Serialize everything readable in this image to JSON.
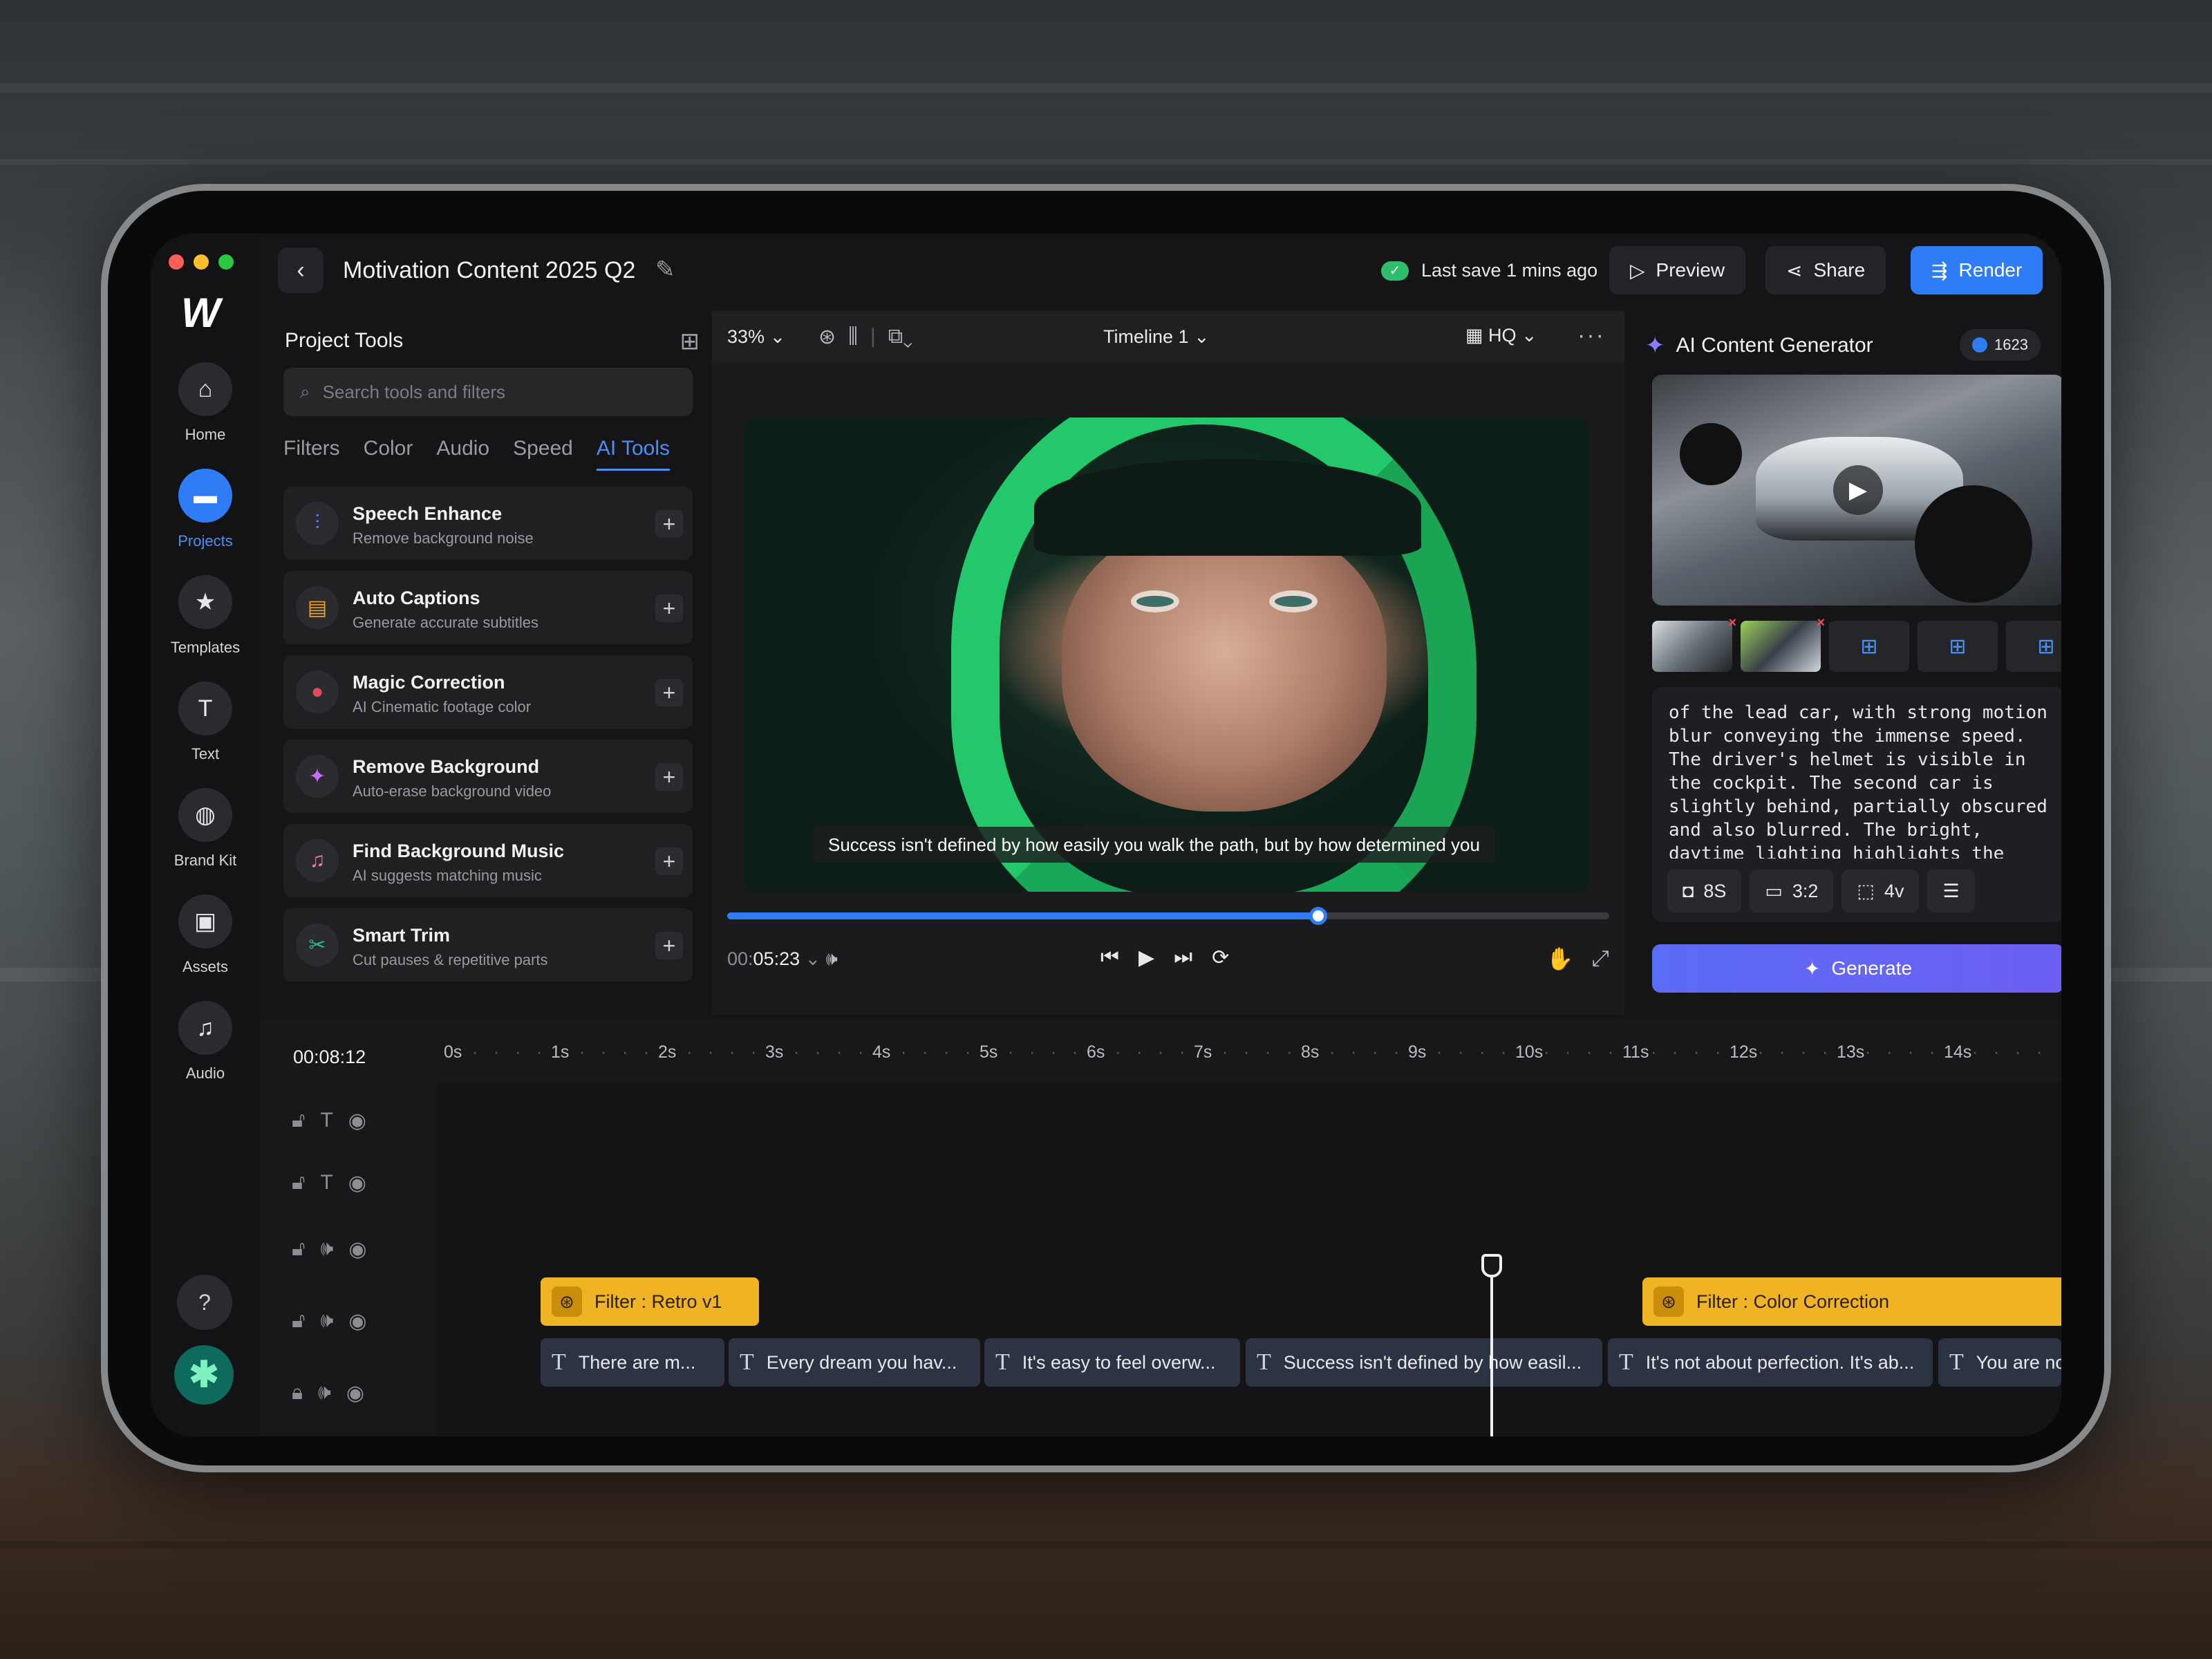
{
  "window": {
    "dots": [
      "#ff5f57",
      "#febc2e",
      "#28c840"
    ]
  },
  "nav": {
    "logo": "W",
    "items": [
      {
        "label": "Home",
        "icon": "home-icon",
        "glyph": "⌂"
      },
      {
        "label": "Projects",
        "icon": "folder-icon",
        "glyph": "▬"
      },
      {
        "label": "Templates",
        "icon": "star-icon",
        "glyph": "★"
      },
      {
        "label": "Text",
        "icon": "text-icon",
        "glyph": "T"
      },
      {
        "label": "Brand Kit",
        "icon": "palette-icon",
        "glyph": "◍"
      },
      {
        "label": "Assets",
        "icon": "image-icon",
        "glyph": "▣"
      },
      {
        "label": "Audio",
        "icon": "music-icon",
        "glyph": "♫"
      }
    ],
    "active": "Projects",
    "help_glyph": "?",
    "avatar_glyph": "✱"
  },
  "header": {
    "title": "Motivation Content 2025 Q2",
    "save_status": "Last save 1 mins ago",
    "preview_label": "Preview",
    "share_label": "Share",
    "render_label": "Render"
  },
  "tools": {
    "title": "Project Tools",
    "search_placeholder": "Search tools and filters",
    "tabs": [
      "Filters",
      "Color",
      "Audio",
      "Speed",
      "AI Tools"
    ],
    "active_tab": "AI Tools",
    "items": [
      {
        "name": "Speech Enhance",
        "desc": "Remove background noise",
        "icon": "waveform-icon",
        "glyph": "⫶",
        "color": "#5b7cf6"
      },
      {
        "name": "Auto Captions",
        "desc": "Generate accurate subtitles",
        "icon": "captions-icon",
        "glyph": "▤",
        "color": "#f0a028"
      },
      {
        "name": "Magic Correction",
        "desc": "AI Cinematic footage color",
        "icon": "color-circles-icon",
        "glyph": "●",
        "color": "#e34b5f"
      },
      {
        "name": "Remove Background",
        "desc": "Auto-erase background video",
        "icon": "magic-wand-icon",
        "glyph": "✦",
        "color": "#c86cf0"
      },
      {
        "name": "Find Background Music",
        "desc": "AI suggests matching music",
        "icon": "music-note-icon",
        "glyph": "♫",
        "color": "#e07ab0"
      },
      {
        "name": "Smart Trim",
        "desc": "Cut pauses & repetitive parts",
        "icon": "scissors-icon",
        "glyph": "✂",
        "color": "#2ebd8b"
      }
    ]
  },
  "preview": {
    "zoom": "33%",
    "timeline_name": "Timeline 1",
    "quality": "HQ",
    "subtitle": "Success isn't defined by how easily you walk the path, but by how determined you",
    "time_dim": "00:",
    "time_main": "05:23",
    "progress": 0.67
  },
  "ai": {
    "title": "AI Content Generator",
    "credits": "1623",
    "prompt": "of the lead car, with strong motion blur conveying the immense speed. The driver's helmet is visible in the cockpit. The second car is slightly behind, partially obscured and also blurred. The bright, daytime lighting highlights the intensity of the rac|",
    "chips": [
      {
        "icon": "video-camera-icon",
        "glyph": "◘",
        "label": "8S"
      },
      {
        "icon": "aspect-ratio-icon",
        "glyph": "▭",
        "label": "3:2"
      },
      {
        "icon": "model-icon",
        "glyph": "⬚",
        "label": "4v"
      },
      {
        "icon": "settings-toggle-icon",
        "glyph": "☰",
        "label": ""
      }
    ],
    "generate_label": "Generate"
  },
  "timeline": {
    "timecode": "00:08:12",
    "ticks": [
      "0s",
      "1s",
      "2s",
      "3s",
      "4s",
      "5s",
      "6s",
      "7s",
      "8s",
      "9s",
      "10s",
      "11s",
      "12s",
      "13s",
      "14s"
    ],
    "filters": [
      {
        "label": "Filter : Retro v1"
      },
      {
        "label": "Filter : Color Correction"
      }
    ],
    "texts": [
      "There are m...",
      "Every dream you hav...",
      "It's easy to feel overw...",
      "Success isn't defined by how easil...",
      "It's not about perfection. It's ab...",
      "You are not alone in t"
    ]
  }
}
